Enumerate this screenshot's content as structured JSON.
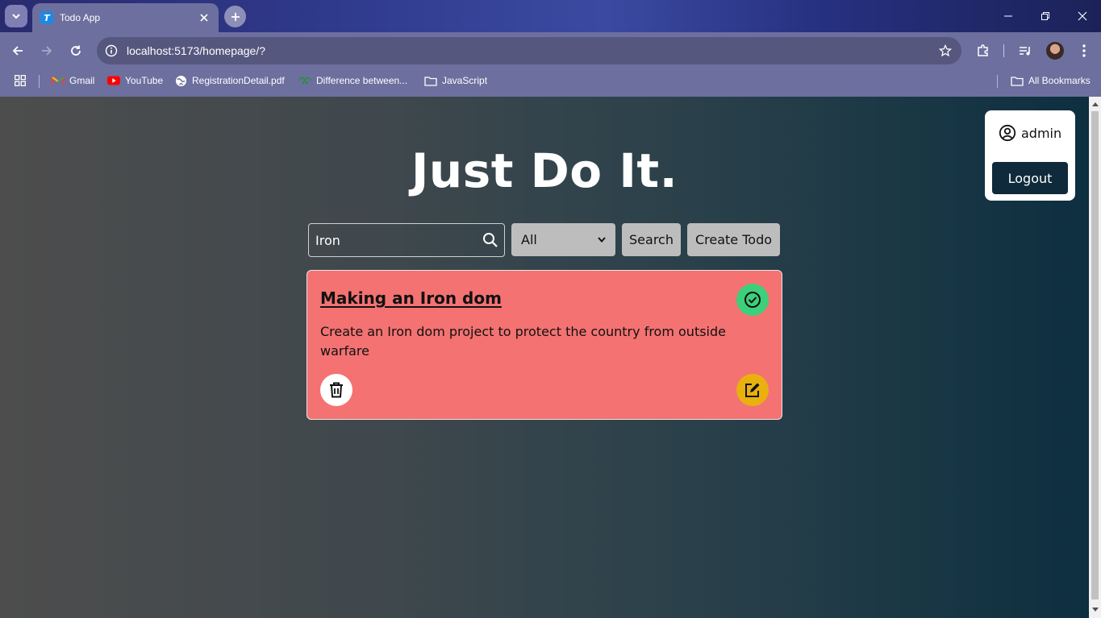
{
  "browser": {
    "tab_title": "Todo App",
    "tab_favicon_letter": "T",
    "url": "localhost:5173/homepage/?",
    "bookmarks": [
      {
        "label": "Gmail",
        "icon": "gmail-icon"
      },
      {
        "label": "YouTube",
        "icon": "youtube-icon"
      },
      {
        "label": "RegistrationDetail.pdf",
        "icon": "globe-icon"
      },
      {
        "label": "Difference between...",
        "icon": "gfg-icon"
      },
      {
        "label": "JavaScript",
        "icon": "folder-icon"
      }
    ],
    "all_bookmarks_label": "All Bookmarks"
  },
  "user": {
    "name": "admin",
    "logout_label": "Logout"
  },
  "hero": {
    "title": "Just Do It."
  },
  "controls": {
    "search_value": "Iron",
    "filter_selected": "All",
    "search_button": "Search",
    "create_button": "Create Todo"
  },
  "todos": [
    {
      "title": "Making an Iron dom",
      "description": "Create an Iron dom project to protect the country from outside warfare",
      "card_color": "#f47272",
      "complete_color": "#3ecf7a",
      "edit_color": "#e8b10e"
    }
  ]
}
